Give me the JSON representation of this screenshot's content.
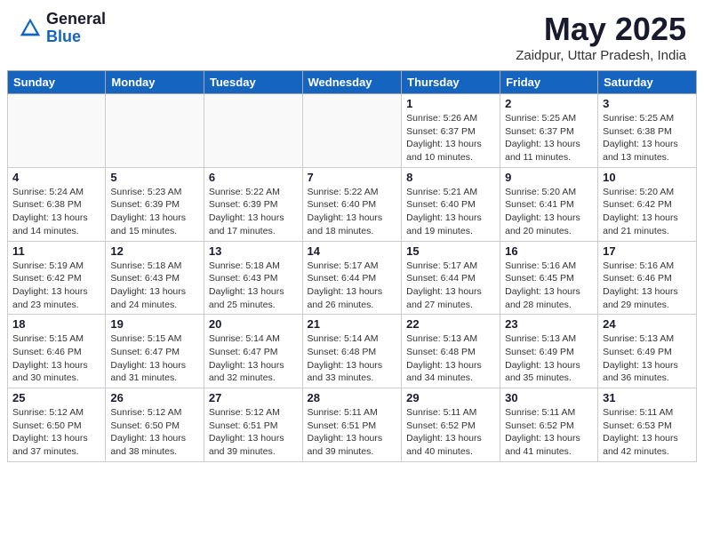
{
  "header": {
    "logo_general": "General",
    "logo_blue": "Blue",
    "month_title": "May 2025",
    "location": "Zaidpur, Uttar Pradesh, India"
  },
  "days_of_week": [
    "Sunday",
    "Monday",
    "Tuesday",
    "Wednesday",
    "Thursday",
    "Friday",
    "Saturday"
  ],
  "weeks": [
    [
      {
        "day": "",
        "info": "",
        "empty": true
      },
      {
        "day": "",
        "info": "",
        "empty": true
      },
      {
        "day": "",
        "info": "",
        "empty": true
      },
      {
        "day": "",
        "info": "",
        "empty": true
      },
      {
        "day": "1",
        "info": "Sunrise: 5:26 AM\nSunset: 6:37 PM\nDaylight: 13 hours\nand 10 minutes.",
        "empty": false
      },
      {
        "day": "2",
        "info": "Sunrise: 5:25 AM\nSunset: 6:37 PM\nDaylight: 13 hours\nand 11 minutes.",
        "empty": false
      },
      {
        "day": "3",
        "info": "Sunrise: 5:25 AM\nSunset: 6:38 PM\nDaylight: 13 hours\nand 13 minutes.",
        "empty": false
      }
    ],
    [
      {
        "day": "4",
        "info": "Sunrise: 5:24 AM\nSunset: 6:38 PM\nDaylight: 13 hours\nand 14 minutes.",
        "empty": false
      },
      {
        "day": "5",
        "info": "Sunrise: 5:23 AM\nSunset: 6:39 PM\nDaylight: 13 hours\nand 15 minutes.",
        "empty": false
      },
      {
        "day": "6",
        "info": "Sunrise: 5:22 AM\nSunset: 6:39 PM\nDaylight: 13 hours\nand 17 minutes.",
        "empty": false
      },
      {
        "day": "7",
        "info": "Sunrise: 5:22 AM\nSunset: 6:40 PM\nDaylight: 13 hours\nand 18 minutes.",
        "empty": false
      },
      {
        "day": "8",
        "info": "Sunrise: 5:21 AM\nSunset: 6:40 PM\nDaylight: 13 hours\nand 19 minutes.",
        "empty": false
      },
      {
        "day": "9",
        "info": "Sunrise: 5:20 AM\nSunset: 6:41 PM\nDaylight: 13 hours\nand 20 minutes.",
        "empty": false
      },
      {
        "day": "10",
        "info": "Sunrise: 5:20 AM\nSunset: 6:42 PM\nDaylight: 13 hours\nand 21 minutes.",
        "empty": false
      }
    ],
    [
      {
        "day": "11",
        "info": "Sunrise: 5:19 AM\nSunset: 6:42 PM\nDaylight: 13 hours\nand 23 minutes.",
        "empty": false
      },
      {
        "day": "12",
        "info": "Sunrise: 5:18 AM\nSunset: 6:43 PM\nDaylight: 13 hours\nand 24 minutes.",
        "empty": false
      },
      {
        "day": "13",
        "info": "Sunrise: 5:18 AM\nSunset: 6:43 PM\nDaylight: 13 hours\nand 25 minutes.",
        "empty": false
      },
      {
        "day": "14",
        "info": "Sunrise: 5:17 AM\nSunset: 6:44 PM\nDaylight: 13 hours\nand 26 minutes.",
        "empty": false
      },
      {
        "day": "15",
        "info": "Sunrise: 5:17 AM\nSunset: 6:44 PM\nDaylight: 13 hours\nand 27 minutes.",
        "empty": false
      },
      {
        "day": "16",
        "info": "Sunrise: 5:16 AM\nSunset: 6:45 PM\nDaylight: 13 hours\nand 28 minutes.",
        "empty": false
      },
      {
        "day": "17",
        "info": "Sunrise: 5:16 AM\nSunset: 6:46 PM\nDaylight: 13 hours\nand 29 minutes.",
        "empty": false
      }
    ],
    [
      {
        "day": "18",
        "info": "Sunrise: 5:15 AM\nSunset: 6:46 PM\nDaylight: 13 hours\nand 30 minutes.",
        "empty": false
      },
      {
        "day": "19",
        "info": "Sunrise: 5:15 AM\nSunset: 6:47 PM\nDaylight: 13 hours\nand 31 minutes.",
        "empty": false
      },
      {
        "day": "20",
        "info": "Sunrise: 5:14 AM\nSunset: 6:47 PM\nDaylight: 13 hours\nand 32 minutes.",
        "empty": false
      },
      {
        "day": "21",
        "info": "Sunrise: 5:14 AM\nSunset: 6:48 PM\nDaylight: 13 hours\nand 33 minutes.",
        "empty": false
      },
      {
        "day": "22",
        "info": "Sunrise: 5:13 AM\nSunset: 6:48 PM\nDaylight: 13 hours\nand 34 minutes.",
        "empty": false
      },
      {
        "day": "23",
        "info": "Sunrise: 5:13 AM\nSunset: 6:49 PM\nDaylight: 13 hours\nand 35 minutes.",
        "empty": false
      },
      {
        "day": "24",
        "info": "Sunrise: 5:13 AM\nSunset: 6:49 PM\nDaylight: 13 hours\nand 36 minutes.",
        "empty": false
      }
    ],
    [
      {
        "day": "25",
        "info": "Sunrise: 5:12 AM\nSunset: 6:50 PM\nDaylight: 13 hours\nand 37 minutes.",
        "empty": false
      },
      {
        "day": "26",
        "info": "Sunrise: 5:12 AM\nSunset: 6:50 PM\nDaylight: 13 hours\nand 38 minutes.",
        "empty": false
      },
      {
        "day": "27",
        "info": "Sunrise: 5:12 AM\nSunset: 6:51 PM\nDaylight: 13 hours\nand 39 minutes.",
        "empty": false
      },
      {
        "day": "28",
        "info": "Sunrise: 5:11 AM\nSunset: 6:51 PM\nDaylight: 13 hours\nand 39 minutes.",
        "empty": false
      },
      {
        "day": "29",
        "info": "Sunrise: 5:11 AM\nSunset: 6:52 PM\nDaylight: 13 hours\nand 40 minutes.",
        "empty": false
      },
      {
        "day": "30",
        "info": "Sunrise: 5:11 AM\nSunset: 6:52 PM\nDaylight: 13 hours\nand 41 minutes.",
        "empty": false
      },
      {
        "day": "31",
        "info": "Sunrise: 5:11 AM\nSunset: 6:53 PM\nDaylight: 13 hours\nand 42 minutes.",
        "empty": false
      }
    ]
  ]
}
